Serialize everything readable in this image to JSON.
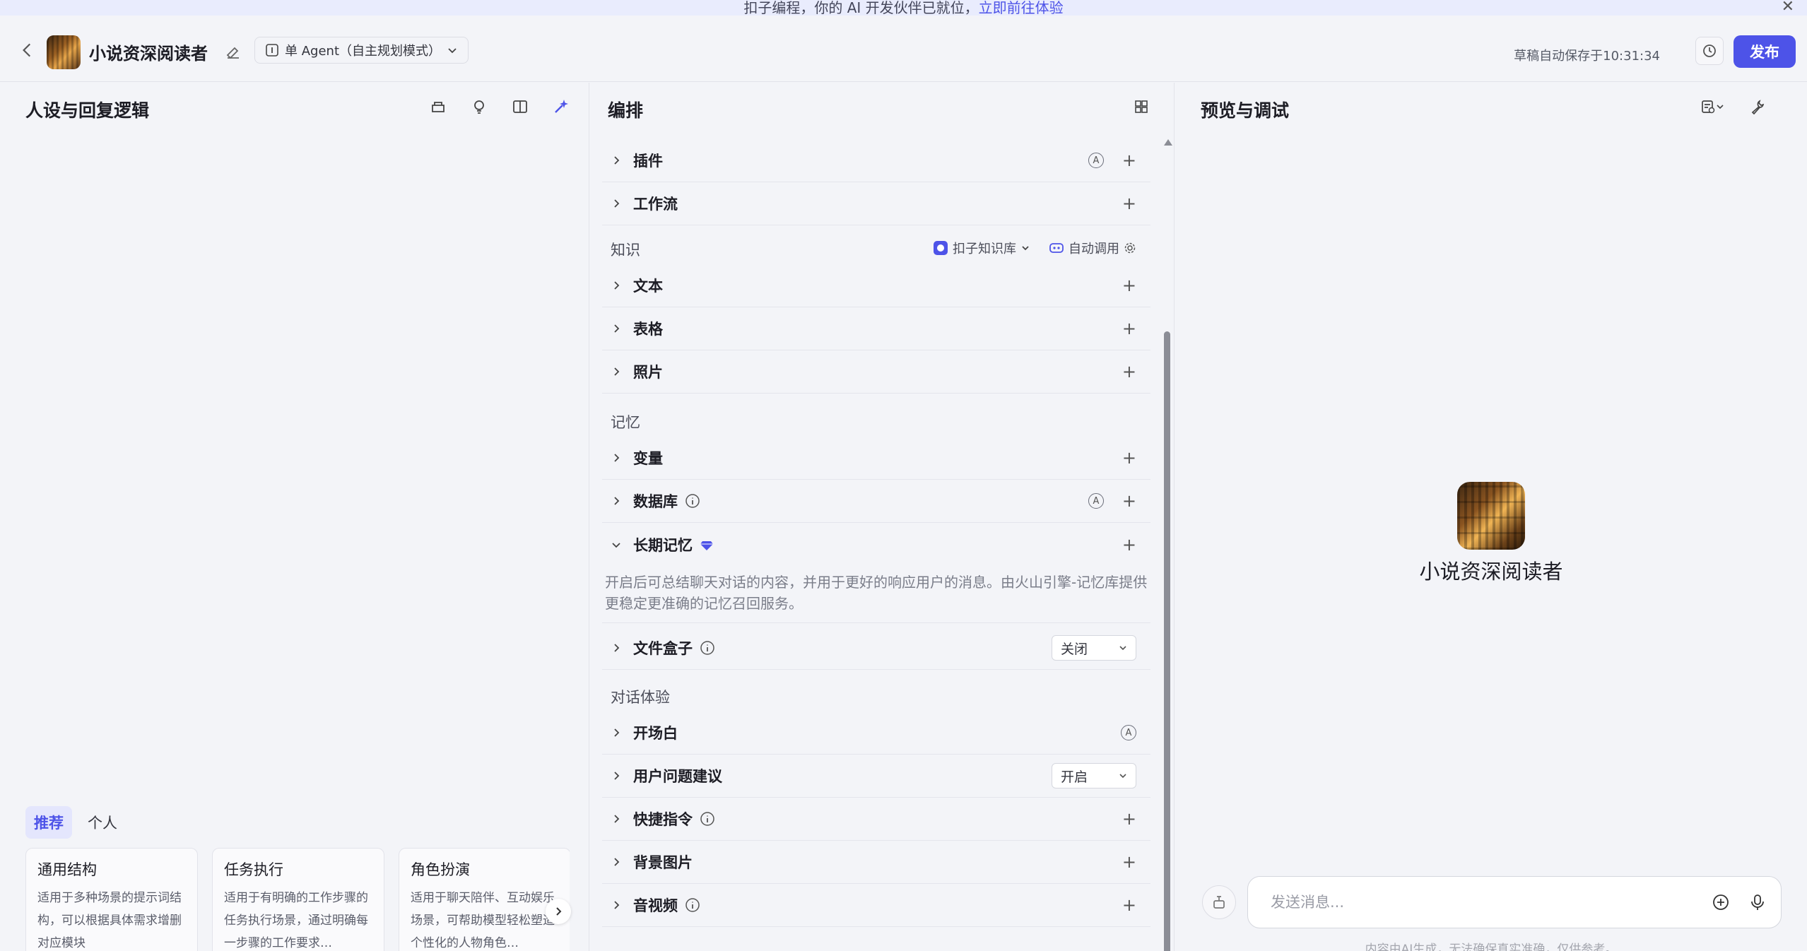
{
  "banner": {
    "text": "扣子编程，你的 AI 开发伙伴已就位，",
    "link": "立即前往体验"
  },
  "header": {
    "bot_name": "小说资深阅读者",
    "mode": "单 Agent（自主规划模式）",
    "autosave": "草稿自动保存于10:31:34",
    "publish": "发布"
  },
  "left": {
    "title": "人设与回复逻辑",
    "tabs": [
      "推荐",
      "个人"
    ],
    "cards": [
      {
        "title": "通用结构",
        "desc": "适用于多种场景的提示词结构，可以根据具体需求增删对应模块"
      },
      {
        "title": "任务执行",
        "desc": "适用于有明确的工作步骤的任务执行场景，通过明确每一步骤的工作要求…"
      },
      {
        "title": "角色扮演",
        "desc": "适用于聊天陪伴、互动娱乐场景，可帮助模型轻松塑造个性化的人物角色…"
      }
    ]
  },
  "mid": {
    "title": "编排",
    "rows": {
      "plugin": "插件",
      "workflow": "工作流",
      "knowledge_section": "知识",
      "kb_source": "扣子知识库",
      "kb_call": "自动调用",
      "text": "文本",
      "table": "表格",
      "photo": "照片",
      "memory_section": "记忆",
      "variable": "变量",
      "database": "数据库",
      "long_memory": "长期记忆",
      "long_memory_desc": "开启后可总结聊天对话的内容，并用于更好的响应用户的消息。由火山引擎-记忆库提供更稳定更准确的记忆召回服务。",
      "filebox": "文件盒子",
      "filebox_value": "关闭",
      "dialog_section": "对话体验",
      "opening": "开场白",
      "suggest": "用户问题建议",
      "suggest_value": "开启",
      "shortcut": "快捷指令",
      "background": "背景图片",
      "av": "音视频"
    }
  },
  "right": {
    "title": "预览与调试",
    "bot_name": "小说资深阅读者",
    "input_placeholder": "发送消息...",
    "disclaimer": "内容由AI生成，无法确保真实准确，仅供参考。"
  },
  "colors": {
    "accent": "#4d53e8",
    "background": "#f3f4f8",
    "banner": "#e9ecfd",
    "memory_gem": "#4d53e8"
  }
}
